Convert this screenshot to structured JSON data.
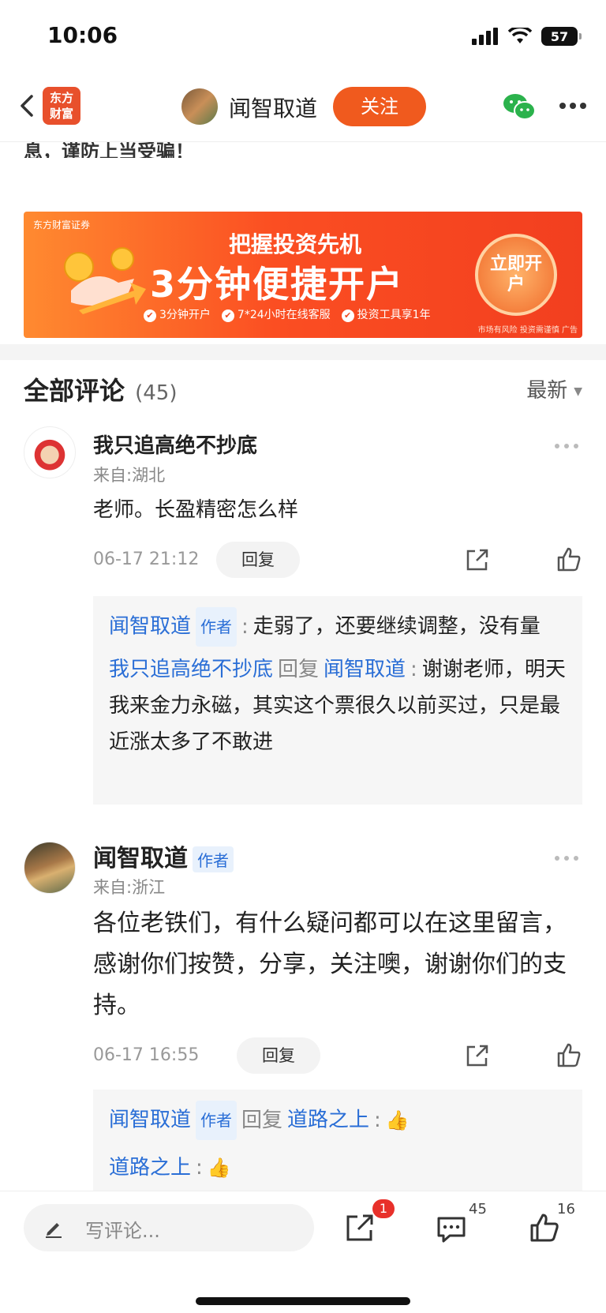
{
  "status_bar": {
    "time": "10:06",
    "battery": "57"
  },
  "nav": {
    "logo_line1": "东方",
    "logo_line2": "财富",
    "title": "闻智取道",
    "follow_label": "关注"
  },
  "article": {
    "cut_text": "息，谨防上当受骗！"
  },
  "ad": {
    "brand": "东方财富证券",
    "title1": "把握投资先机",
    "title2": "3分钟便捷开户",
    "features": [
      "3分钟开户",
      "7*24小时在线客服",
      "投资工具享1年"
    ],
    "button": "立即开户",
    "disclaimer": "市场有风险 投资需谨慎 广告"
  },
  "comments_header": {
    "title": "全部评论",
    "count": "(45)",
    "sort": "最新"
  },
  "comments": [
    {
      "username": "我只追高绝不抄底",
      "location": "来自:湖北",
      "text": "老师。长盈精密怎么样",
      "time": "06-17 21:12",
      "reply_label": "回复",
      "replies": [
        {
          "name": "闻智取道",
          "badge": "作者",
          "sep": ":",
          "text": "走弱了，还要继续调整，没有量"
        },
        {
          "name": "我只追高绝不抄底",
          "reply_word": "回复",
          "target": "闻智取道",
          "sep": ":",
          "text": "谢谢老师，明天我来金力永磁，其实这个票很久以前买过，只是最近涨太多了不敢进"
        }
      ]
    },
    {
      "username": "闻智取道",
      "badge": "作者",
      "location": "来自:浙江",
      "text": "各位老铁们，有什么疑问都可以在这里留言， 感谢你们按赞，分享，关注噢，谢谢你们的支持。",
      "time": "06-17 16:55",
      "reply_label": "回复",
      "replies": [
        {
          "name": "闻智取道",
          "badge": "作者",
          "reply_word": "回复",
          "target": "道路之上",
          "sep": ":",
          "emoji": "👍"
        },
        {
          "name": "道路之上",
          "sep": ":",
          "emoji": "👍"
        }
      ]
    }
  ],
  "bottom_bar": {
    "placeholder": "写评论...",
    "share_badge": "1",
    "comment_count": "45",
    "like_count": "16"
  }
}
